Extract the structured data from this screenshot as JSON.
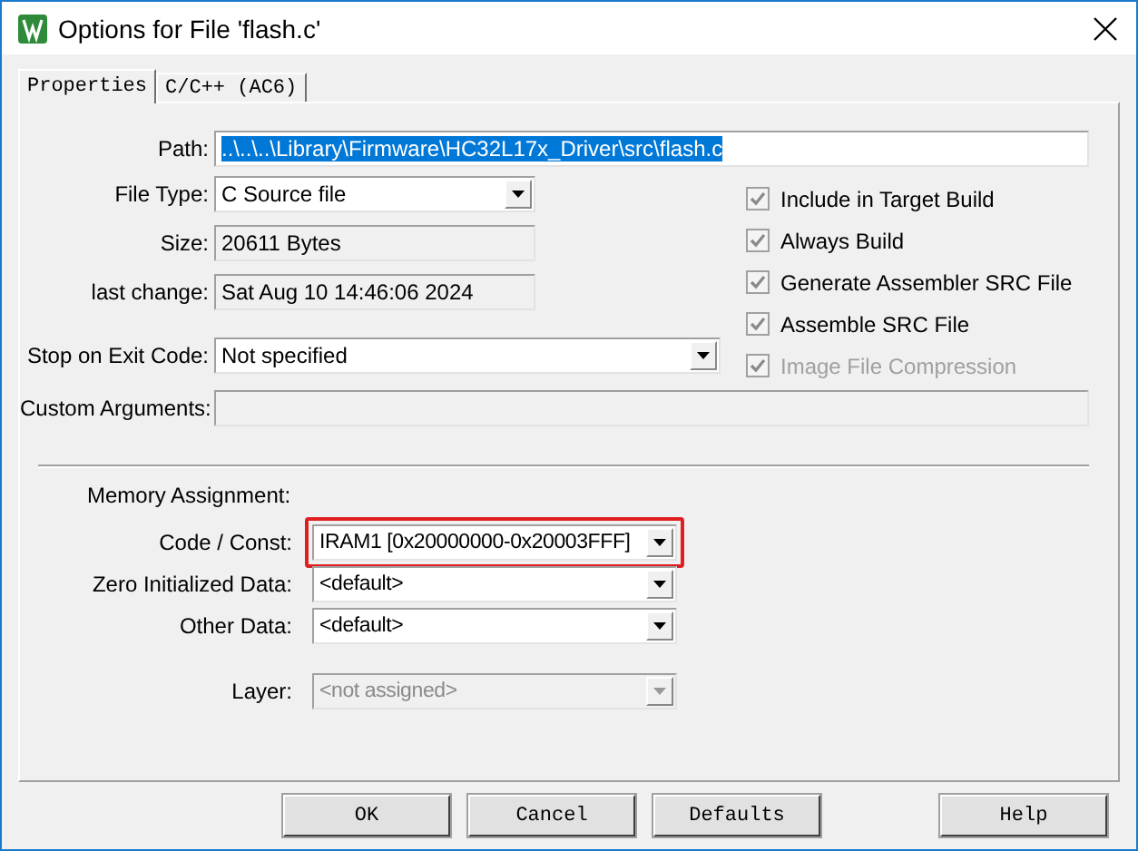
{
  "window": {
    "title": "Options for File 'flash.c'"
  },
  "tabs": [
    {
      "label": "Properties",
      "selected": true
    },
    {
      "label": "C/C++ (AC6)",
      "selected": false
    }
  ],
  "path": {
    "label": "Path:",
    "value": "..\\..\\..\\Library\\Firmware\\HC32L17x_Driver\\src\\flash.c",
    "text_selected": true
  },
  "file_info": [
    {
      "label": "File Type:",
      "kind": "combo",
      "value": "C Source file"
    },
    {
      "label": "Size:",
      "kind": "readonly",
      "value": "20611 Bytes"
    },
    {
      "label": "last change:",
      "kind": "readonly",
      "value": "Sat Aug 10 14:46:06 2024"
    }
  ],
  "stop_on_exit_code": {
    "label": "Stop on Exit Code:",
    "kind": "combo",
    "value": "Not specified"
  },
  "custom_arguments": {
    "label": "Custom Arguments:",
    "kind": "readonly"
  },
  "options": [
    {
      "label": "Include in Target Build",
      "checked": true,
      "disabled": false
    },
    {
      "label": "Always Build",
      "checked": true,
      "disabled": false
    },
    {
      "label": "Generate Assembler SRC File",
      "checked": true,
      "disabled": false
    },
    {
      "label": "Assemble SRC File",
      "checked": true,
      "disabled": false
    },
    {
      "label": "Image File Compression",
      "checked": true,
      "disabled": true
    }
  ],
  "memory": {
    "label": "Memory Assignment:",
    "rows": [
      {
        "label": "Code / Const:",
        "value": "IRAM1 [0x20000000-0x20003FFF]",
        "disabled": false,
        "highlighted": true
      },
      {
        "label": "Zero Initialized Data:",
        "value": "<default>",
        "disabled": false,
        "highlighted": false
      },
      {
        "label": "Other Data:",
        "value": "<default>",
        "disabled": false,
        "highlighted": false
      },
      {
        "label": "Layer:",
        "value": "<not assigned>",
        "disabled": true,
        "highlighted": false
      }
    ]
  },
  "buttons": [
    "OK",
    "Cancel",
    "Defaults",
    "Help"
  ]
}
